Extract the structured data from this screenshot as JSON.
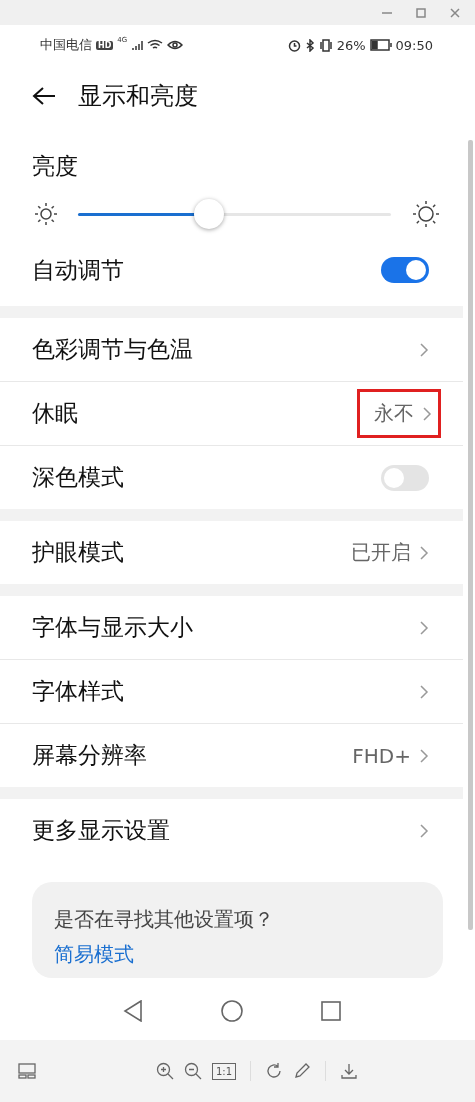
{
  "status_bar": {
    "carrier": "中国电信",
    "hd": "HD",
    "network": "4G",
    "battery": "26%",
    "time": "09:50"
  },
  "header": {
    "title": "显示和亮度"
  },
  "brightness": {
    "label": "亮度",
    "level": 0.42
  },
  "auto_adjust": {
    "label": "自动调节",
    "on": true
  },
  "groups": [
    [
      {
        "kind": "link",
        "label": "色彩调节与色温",
        "highlighted": false
      },
      {
        "kind": "link",
        "label": "休眠",
        "value": "永不",
        "highlighted": true
      },
      {
        "kind": "toggle",
        "label": "深色模式",
        "on": false
      }
    ],
    [
      {
        "kind": "link",
        "label": "护眼模式",
        "value": "已开启",
        "highlighted": false
      }
    ],
    [
      {
        "kind": "link",
        "label": "字体与显示大小",
        "highlighted": false
      },
      {
        "kind": "link",
        "label": "字体样式",
        "highlighted": false
      },
      {
        "kind": "link",
        "label": "屏幕分辨率",
        "value": "FHD+",
        "highlighted": false
      }
    ],
    [
      {
        "kind": "link",
        "label": "更多显示设置",
        "highlighted": false
      }
    ]
  ],
  "suggestion_card": {
    "question": "是否在寻找其他设置项？",
    "link": "简易模式"
  },
  "viewer_toolbar": {
    "actual_size": "1:1"
  }
}
